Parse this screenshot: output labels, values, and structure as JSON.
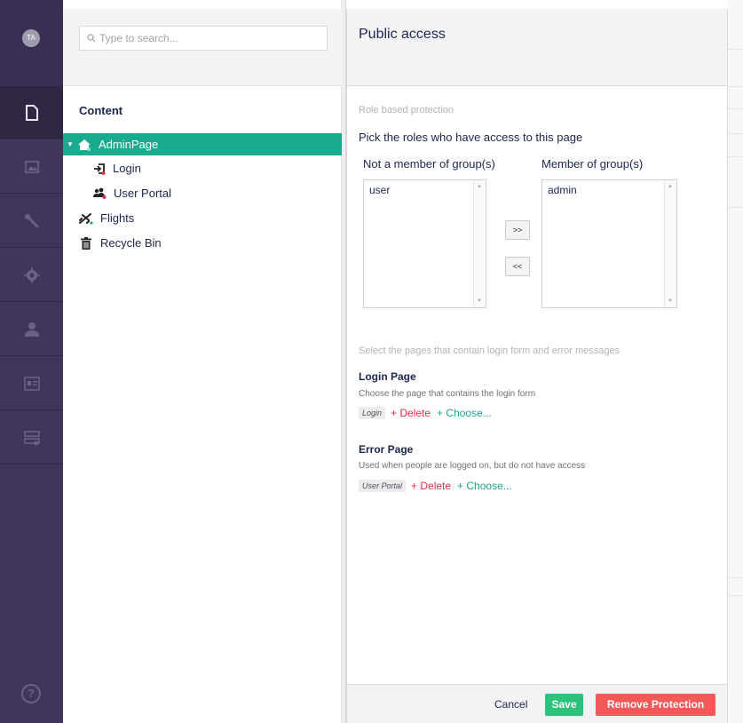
{
  "user": {
    "initials": "TA"
  },
  "search": {
    "placeholder": "Type to search..."
  },
  "tree": {
    "title": "Content",
    "nodes": [
      {
        "label": "AdminPage"
      },
      {
        "label": "Login"
      },
      {
        "label": "User Portal"
      },
      {
        "label": "Flights"
      },
      {
        "label": "Recycle Bin"
      }
    ]
  },
  "dialog": {
    "title": "Public access",
    "section_label": "Role based protection",
    "instruction": "Pick the roles who have access to this page",
    "not_member_label": "Not a member of group(s)",
    "member_label": "Member of group(s)",
    "not_member_items": [
      "user"
    ],
    "member_items": [
      "admin"
    ],
    "move_right_label": ">>",
    "move_left_label": "<<",
    "pages_hint": "Select the pages that contain login form and error messages",
    "login_page": {
      "title": "Login Page",
      "description": "Choose the page that contains the login form",
      "selected": "Login",
      "delete_label": "+ Delete",
      "choose_label": "+ Choose..."
    },
    "error_page": {
      "title": "Error Page",
      "description": "Used when people are logged on, but do not have access",
      "selected": "User Portal",
      "delete_label": "+ Delete",
      "choose_label": "+ Choose..."
    },
    "footer": {
      "cancel_label": "Cancel",
      "save_label": "Save",
      "remove_label": "Remove Protection"
    }
  },
  "colors": {
    "rail": "#413659",
    "selected_node": "#1aaa8d",
    "save": "#2bc37c",
    "remove": "#f25a5a",
    "delete_link": "#e02f48",
    "choose_link": "#1aa68a"
  },
  "icons": {
    "rail": [
      "content-icon",
      "media-icon",
      "settings-wrench-icon",
      "gear-icon",
      "user-icon",
      "members-icon",
      "forms-icon",
      "help-icon"
    ]
  }
}
